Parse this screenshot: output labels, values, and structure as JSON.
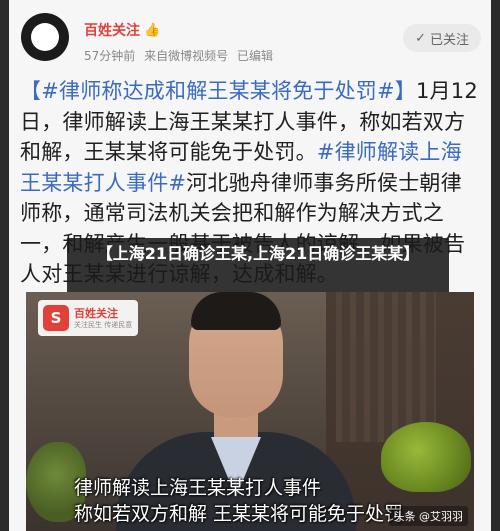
{
  "header": {
    "author_name": "百姓关注",
    "author_badge_icon": "thumbs-up-hand-icon",
    "time_ago": "57分钟前",
    "source": "来自微博视频号",
    "edited": "已编辑",
    "follow_label": "已关注"
  },
  "post": {
    "hashtag1": "【#律师称达成和解王某某将免于处罚#】",
    "text1": "1月12日，律师解读上海王某某打人事件，称如若双方和解，王某某将可能免于处罚。",
    "hashtag2": "#律师解读上海王某某打人事件#",
    "text2": "河北驰舟律师事务所侯士朝律师称，通常司法机关会把和解作为解决方式之一，和解产生一般基于被告人的谅解，如果被告人对王某某进行谅解，达成和解。"
  },
  "overlay_title": "【上海21日确诊王某,上海21日确诊王某某】",
  "video": {
    "logo_title": "百姓关注",
    "logo_sub": "关注民生 传递民意",
    "caption_line1": "律师解读上海王某某打人事件",
    "caption_line2": "称如若双方和解  王某某将可能免于处罚",
    "watermark": "头条 @艾羽羽"
  },
  "colors": {
    "brand_red": "#e0413b",
    "hashtag_blue": "#3b6ac2"
  }
}
